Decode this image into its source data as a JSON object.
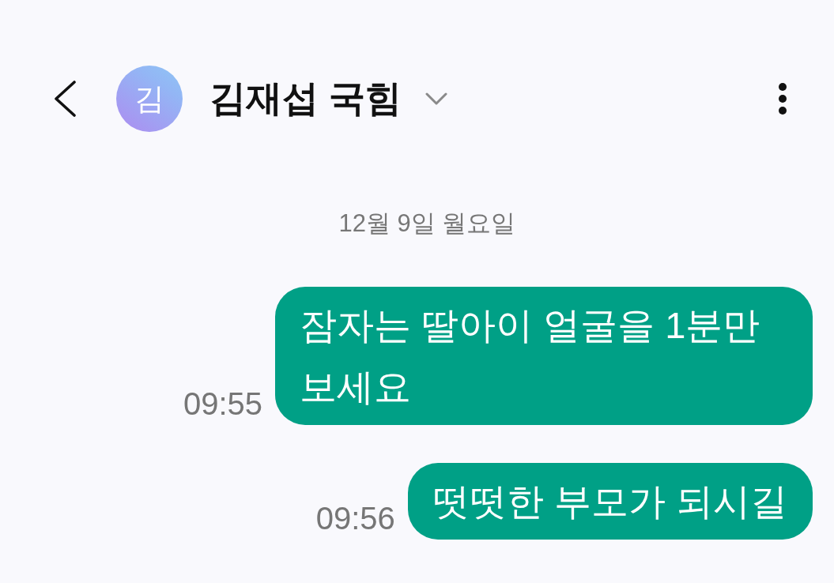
{
  "header": {
    "avatar_initial": "김",
    "contact_name": "김재섭 국힘"
  },
  "date_separator": "12월 9일 월요일",
  "messages": [
    {
      "text": "잠자는 딸아이 얼굴을 1분만 보세요",
      "time": "09:55",
      "outgoing": true
    },
    {
      "text": "떳떳한 부모가 되시길",
      "time": "09:56",
      "outgoing": true
    }
  ]
}
